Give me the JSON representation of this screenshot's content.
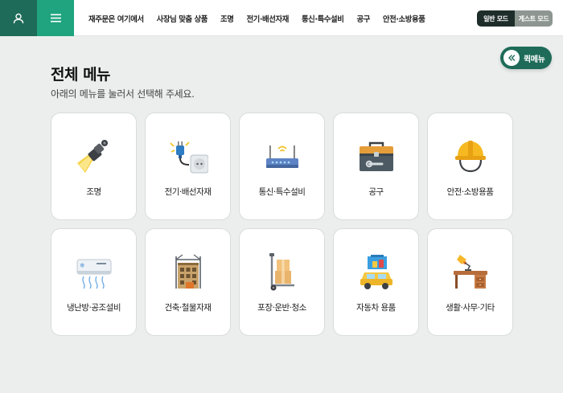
{
  "header": {
    "nav": [
      "재주문은 여기에서",
      "사장님 맞춤 상품",
      "조명",
      "전기·배선자재",
      "통신·특수설비",
      "공구",
      "안전·소방용품"
    ],
    "mode": {
      "normal": "일반 모드",
      "guest": "게스트 모드"
    },
    "colors": {
      "user_button": "#1d6b58",
      "menu_button": "#1fa47f"
    }
  },
  "quick_menu": {
    "label": "퀵메뉴",
    "icon": "chevron-double-left-icon"
  },
  "main": {
    "title": "전체 메뉴",
    "subtitle": "아래의 메뉴를 눌러서 선택해 주세요.",
    "categories": [
      {
        "label": "조명",
        "icon": "spotlight-icon"
      },
      {
        "label": "전기·배선자재",
        "icon": "plug-outlet-icon"
      },
      {
        "label": "통신·특수설비",
        "icon": "router-icon"
      },
      {
        "label": "공구",
        "icon": "toolbox-icon"
      },
      {
        "label": "안전·소방용품",
        "icon": "hardhat-icon"
      },
      {
        "label": "냉난방·공조설비",
        "icon": "air-conditioner-icon"
      },
      {
        "label": "건축·철물자재",
        "icon": "building-construction-icon"
      },
      {
        "label": "포장·운반·청소",
        "icon": "hand-truck-icon"
      },
      {
        "label": "자동차 용품",
        "icon": "car-icon"
      },
      {
        "label": "생활·사무·기타",
        "icon": "desk-lamp-icon"
      }
    ]
  }
}
